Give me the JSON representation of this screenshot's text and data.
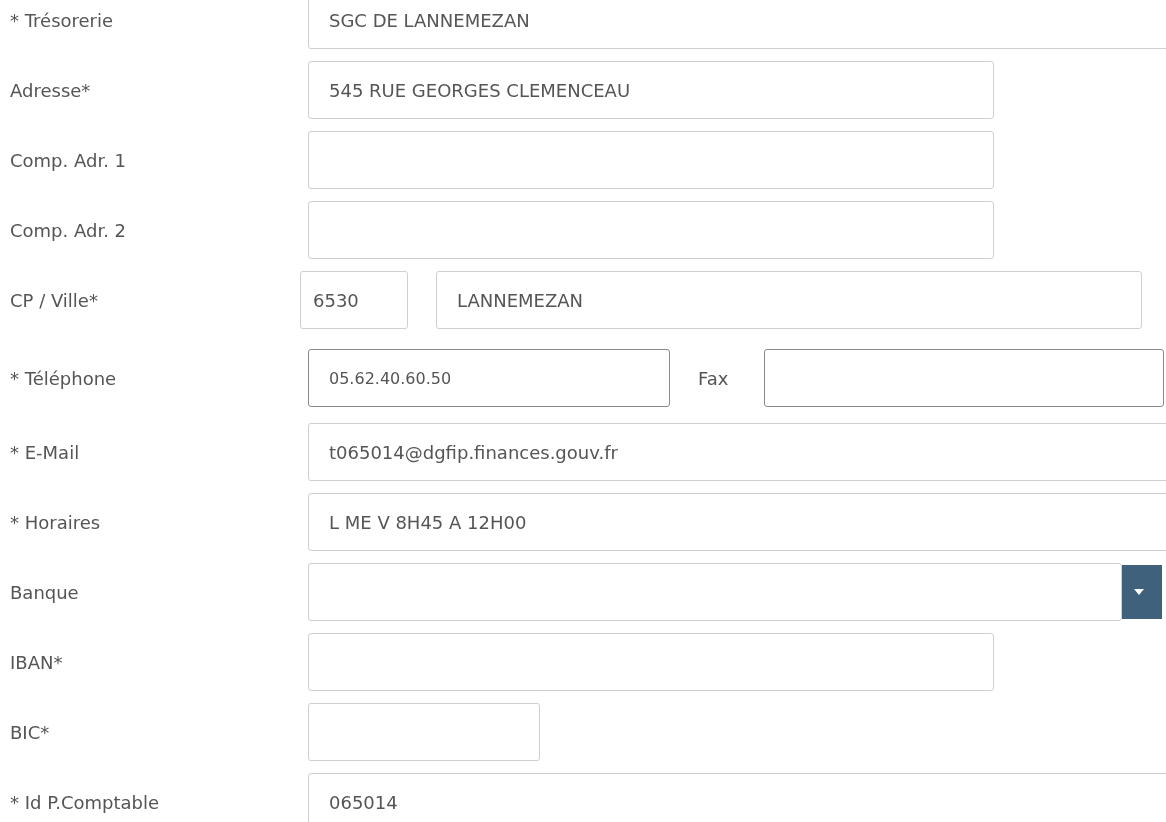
{
  "fields": [
    {
      "kind": "wide",
      "label": "* Trésorerie",
      "value": "SGC DE LANNEMEZAN"
    },
    {
      "kind": "text",
      "label": "Adresse*",
      "value": "545 RUE GEORGES CLEMENCEAU"
    },
    {
      "kind": "text",
      "label": "Comp. Adr. 1"
    },
    {
      "kind": "text",
      "label": "Comp. Adr. 2"
    },
    {
      "kind": "cp",
      "label": "CP / Ville*",
      "postcode": "6530",
      "city": "LANNEMEZAN"
    },
    {
      "kind": "phone",
      "label": "* Téléphone",
      "value": "05.62.40.60.50",
      "fax_label": "Fax"
    },
    {
      "kind": "wide",
      "label": "* E-Mail",
      "value": "t065014@dgfip.finances.gouv.fr"
    },
    {
      "kind": "wide",
      "label": "* Horaires",
      "value": "L ME V 8H45 A 12H00"
    },
    {
      "kind": "select",
      "label": "Banque"
    },
    {
      "kind": "text",
      "label": "IBAN*"
    },
    {
      "kind": "short",
      "label": "BIC*"
    },
    {
      "kind": "wide",
      "label": "* Id P.Comptable",
      "value": "065014"
    }
  ]
}
